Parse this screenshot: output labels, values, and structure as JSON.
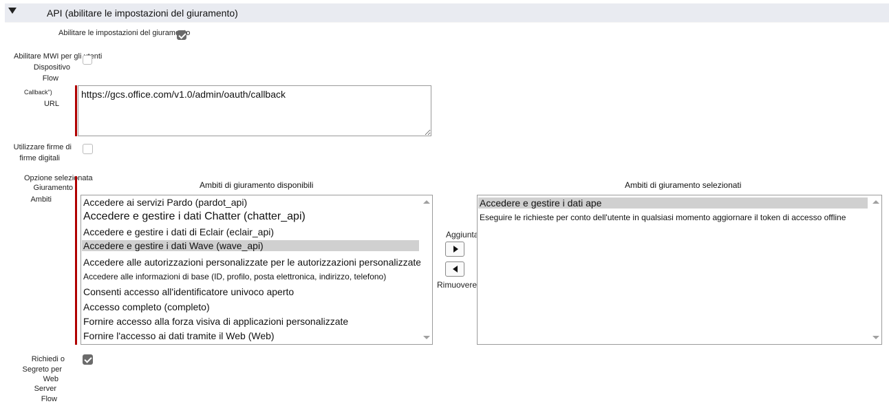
{
  "section": {
    "title": "API (abilitare le impostazioni del giuramento)"
  },
  "fields": {
    "enable_oauth_label": "Abilitare le impostazioni del giuramento",
    "device_flow_label": [
      "Abilitare MWI per gli utenti",
      "Dispositivo",
      "Flow"
    ],
    "callback_label": [
      "Callback\")",
      "URL"
    ],
    "callback_url_value": "https://gcs.office.com/v1.0/admin/oauth/callback",
    "digital_signatures_label": [
      "Utilizzare firme di",
      "firme digitali"
    ],
    "scopes_label": [
      "Opzione selezionata",
      "Giuramento",
      "Ambiti"
    ],
    "require_secret_label": [
      "Richiedi o",
      "Segreto per",
      "Web",
      "Server",
      "Flow"
    ]
  },
  "available_scopes": {
    "header": "Ambiti di giuramento disponibili",
    "items": [
      "Accedere ai servizi Pardo (pardot_api)",
      "Accedere e gestire i dati Chatter (chatter_api)",
      "Accedere e gestire i dati di Eclair (eclair_api)",
      "Accedere e gestire i dati Wave (wave_api)",
      "Accedere alle autorizzazioni personalizzate per le autorizzazioni personalizzate",
      "Accedere alle informazioni di base (ID, profilo, posta elettronica, indirizzo, telefono)",
      "Consenti accesso all'identificatore univoco aperto",
      "Accesso completo (completo)",
      "Fornire accesso alla forza visiva di applicazioni personalizzate",
      "Fornire l'accesso ai dati tramite il Web (Web)"
    ],
    "selected_index": 3
  },
  "selected_scopes": {
    "header": "Ambiti di giuramento selezionati",
    "items": [
      "Accedere e gestire i dati ape",
      "Eseguire le richieste per conto dell'utente in qualsiasi momento aggiornare il token di accesso offline"
    ],
    "selected_index": 0
  },
  "buttons": {
    "add_label": "Aggiunta",
    "remove_label": "Rimuovere"
  },
  "state": {
    "enable_oauth_checked": true,
    "device_flow_checked": false,
    "digital_signatures_checked": false,
    "require_secret_checked": true
  },
  "colors": {
    "header_bg": "#e9ebf1",
    "required_bar": "#b00000",
    "selection_bg": "#d0d0d0"
  }
}
